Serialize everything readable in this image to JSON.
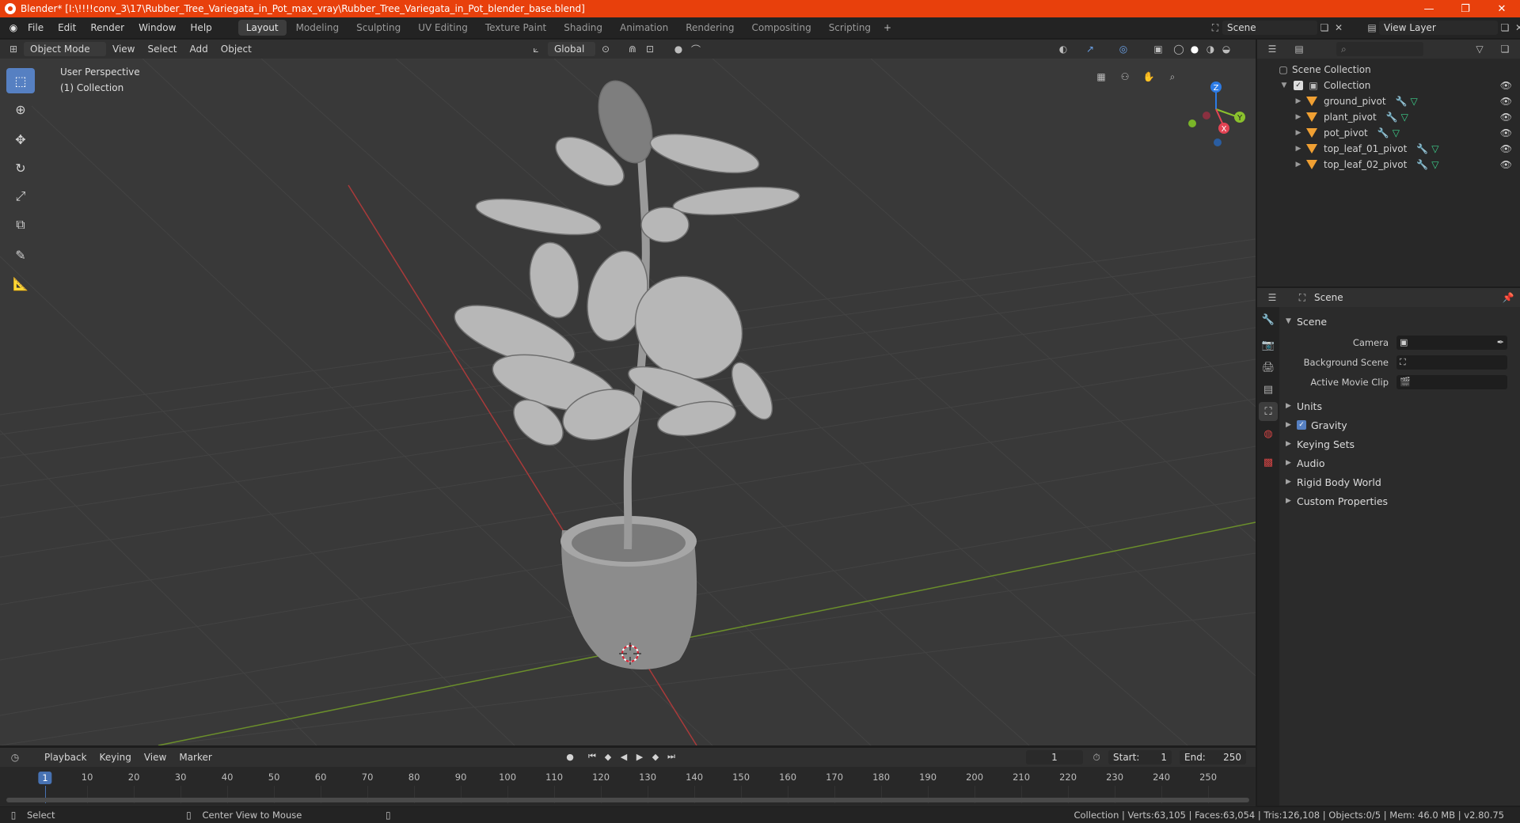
{
  "window": {
    "title": "Blender* [I:\\!!!!conv_3\\17\\Rubber_Tree_Variegata_in_Pot_max_vray\\Rubber_Tree_Variegata_in_Pot_blender_base.blend]",
    "accent_color": "#e8400c"
  },
  "menus": [
    "File",
    "Edit",
    "Render",
    "Window",
    "Help"
  ],
  "workspaces": [
    {
      "label": "Layout",
      "active": true
    },
    {
      "label": "Modeling"
    },
    {
      "label": "Sculpting"
    },
    {
      "label": "UV Editing"
    },
    {
      "label": "Texture Paint"
    },
    {
      "label": "Shading"
    },
    {
      "label": "Animation"
    },
    {
      "label": "Rendering"
    },
    {
      "label": "Compositing"
    },
    {
      "label": "Scripting"
    }
  ],
  "scene_selector": {
    "value": "Scene"
  },
  "view_layer_selector": {
    "value": "View Layer"
  },
  "viewport_header": {
    "mode": "Object Mode",
    "menus": [
      "View",
      "Select",
      "Add",
      "Object"
    ],
    "transform_orientation": "Global"
  },
  "viewport": {
    "perspective_label": "User Perspective",
    "collection_label": "(1) Collection"
  },
  "outliner": {
    "root": "Scene Collection",
    "collection": "Collection",
    "objects": [
      "ground_pivot",
      "plant_pivot",
      "pot_pivot",
      "top_leaf_01_pivot",
      "top_leaf_02_pivot"
    ]
  },
  "properties": {
    "context": "Scene",
    "panel_title": "Scene",
    "fields": {
      "camera_label": "Camera",
      "background_scene_label": "Background Scene",
      "active_movie_clip_label": "Active Movie Clip"
    },
    "subpanels": [
      "Units",
      "Gravity",
      "Keying Sets",
      "Audio",
      "Rigid Body World",
      "Custom Properties"
    ]
  },
  "timeline": {
    "menus": [
      "Playback",
      "Keying",
      "View",
      "Marker"
    ],
    "current_frame": "1",
    "start_label": "Start:",
    "start": "1",
    "end_label": "End:",
    "end": "250",
    "ruler": [
      "1",
      "10",
      "20",
      "30",
      "40",
      "50",
      "60",
      "70",
      "80",
      "90",
      "100",
      "110",
      "120",
      "130",
      "140",
      "150",
      "160",
      "170",
      "180",
      "190",
      "200",
      "210",
      "220",
      "230",
      "240",
      "250"
    ]
  },
  "statusbar": {
    "left_action": "Select",
    "middle_action": "Center View to Mouse",
    "stats": "Collection | Verts:63,105 | Faces:63,054 | Tris:126,108 | Objects:0/5 | Mem: 46.0 MB | v2.80.75"
  }
}
